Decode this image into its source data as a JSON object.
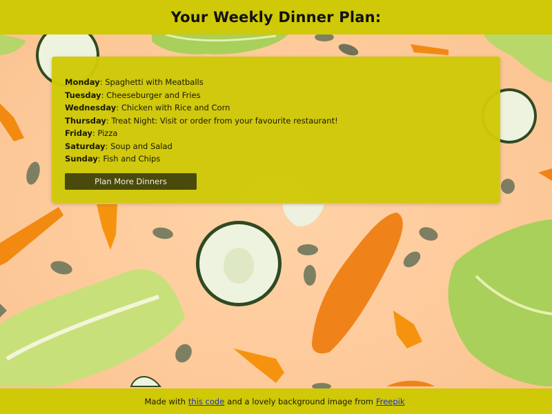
{
  "header": {
    "title": "Your Weekly Dinner Plan:"
  },
  "plan": {
    "items": [
      {
        "day": "Monday",
        "meal": "Spaghetti with Meatballs"
      },
      {
        "day": "Tuesday",
        "meal": "Cheeseburger and Fries"
      },
      {
        "day": "Wednesday",
        "meal": "Chicken with Rice and Corn"
      },
      {
        "day": "Thursday",
        "meal": "Treat Night: Visit or order from your favourite restaurant!"
      },
      {
        "day": "Friday",
        "meal": "Pizza"
      },
      {
        "day": "Saturday",
        "meal": "Soup and Salad"
      },
      {
        "day": "Sunday",
        "meal": "Fish and Chips"
      }
    ],
    "separator": ": ",
    "button_label": "Plan More Dinners"
  },
  "footer": {
    "prefix": "Made with",
    "code_link": "this code",
    "middle": "and a lovely background image from",
    "credit_link": "Freepik"
  },
  "colors": {
    "bar": "#cfc907",
    "button": "#4a4a0c",
    "background": "#fdc99a",
    "link": "#1a2bd6"
  }
}
